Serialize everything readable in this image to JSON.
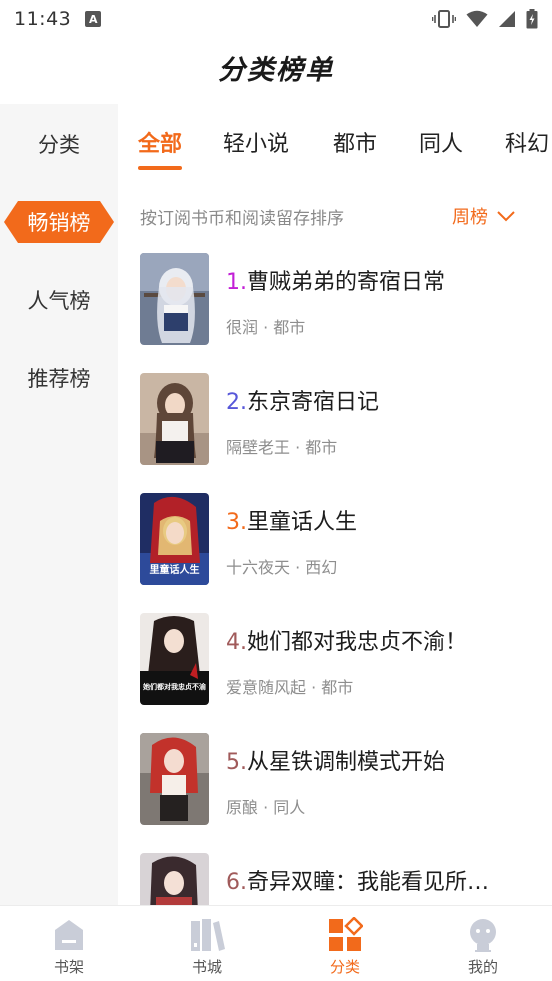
{
  "status_bar": {
    "time": "11:43",
    "notification_glyph": "A",
    "icons": [
      "vibrate-icon",
      "wifi-icon",
      "signal-icon",
      "battery-icon"
    ]
  },
  "page": {
    "title": "分类榜单"
  },
  "sidebar": {
    "items": [
      {
        "label": "分类"
      },
      {
        "label": "畅销榜",
        "active": true
      },
      {
        "label": "人气榜"
      },
      {
        "label": "推荐榜"
      }
    ]
  },
  "tabs": [
    {
      "label": "全部",
      "active": true
    },
    {
      "label": "轻小说"
    },
    {
      "label": "都市"
    },
    {
      "label": "同人"
    },
    {
      "label": "科幻"
    }
  ],
  "sort": {
    "description": "按订阅书币和阅读留存排序",
    "selected": "周榜"
  },
  "books": [
    {
      "rank": "1.",
      "name": "曹贼弟弟的寄宿日常",
      "meta": "很润 · 都市"
    },
    {
      "rank": "2.",
      "name": "东京寄宿日记",
      "meta": "隔壁老王 · 都市"
    },
    {
      "rank": "3.",
      "name": "里童话人生",
      "meta": "十六夜天 · 西幻"
    },
    {
      "rank": "4.",
      "name": "她们都对我忠贞不渝！",
      "meta": "爱意随风起 · 都市"
    },
    {
      "rank": "5.",
      "name": "从星铁调制模式开始",
      "meta": "原酿 · 同人"
    },
    {
      "rank": "6.",
      "name": "奇异双瞳：我能看见所…",
      "meta": ""
    }
  ],
  "covers": [
    {
      "cover_text": ""
    },
    {
      "cover_text": ""
    },
    {
      "cover_text": "里童话人生"
    },
    {
      "cover_text": "她们都对我忠贞不渝"
    },
    {
      "cover_text": ""
    },
    {
      "cover_text": ""
    }
  ],
  "rank_colors": [
    "#c21fd6",
    "#5757d9",
    "#f26a1b",
    "#a05a5a",
    "#a05a5a",
    "#a05a5a"
  ],
  "accent_color": "#f26a1b",
  "bottom_nav": [
    {
      "label": "书架",
      "icon": "bookshelf-icon"
    },
    {
      "label": "书城",
      "icon": "bookstore-icon"
    },
    {
      "label": "分类",
      "icon": "category-icon",
      "active": true
    },
    {
      "label": "我的",
      "icon": "profile-icon"
    }
  ]
}
